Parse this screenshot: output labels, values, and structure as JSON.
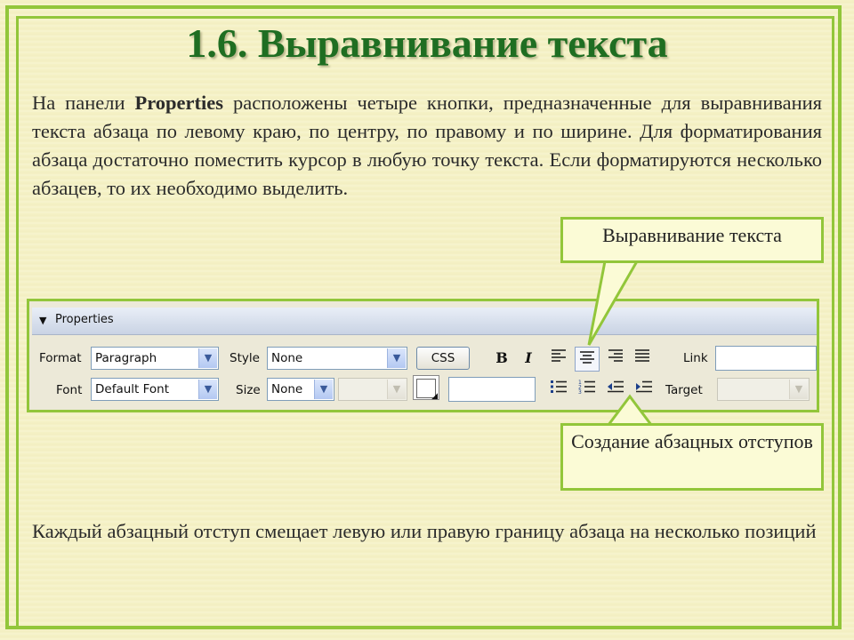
{
  "slide": {
    "title": "1.6. Выравнивание текста",
    "intro_before": "На панели ",
    "intro_bold": "Properties",
    "intro_after": " расположены четыре кнопки, предназначенные для выравнивания текста абзаца по левому краю, по центру, по правому и по ширине. Для форматирования абзаца достаточно поместить курсор в любую точку текста. Если форматируются несколько абзацев, то их необходимо выделить.",
    "footer_text": "Каждый абзацный отступ смещает левую или правую границу абзаца на несколько позиций",
    "callout_align": "Выравнивание текста",
    "callout_indent": "Создание абзацных отступов"
  },
  "panel": {
    "title": "Properties",
    "format_label": "Format",
    "format_value": "Paragraph",
    "style_label": "Style",
    "style_value": "None",
    "css_button": "CSS",
    "bold_label": "B",
    "italic_label": "I",
    "link_label": "Link",
    "link_value": "",
    "font_label": "Font",
    "font_value": "Default Font",
    "size_label": "Size",
    "size_value": "None",
    "target_label": "Target"
  },
  "icons": [
    "collapse-triangle-icon",
    "dropdown-arrow-icon",
    "bold-icon",
    "italic-icon",
    "align-left-icon",
    "align-center-icon",
    "align-right-icon",
    "justify-icon",
    "unordered-list-icon",
    "ordered-list-icon",
    "outdent-icon",
    "indent-icon",
    "color-swatch-icon"
  ],
  "colors": {
    "frame": "#92c63a",
    "title": "#1f6e22",
    "background": "#f5f2c6"
  }
}
